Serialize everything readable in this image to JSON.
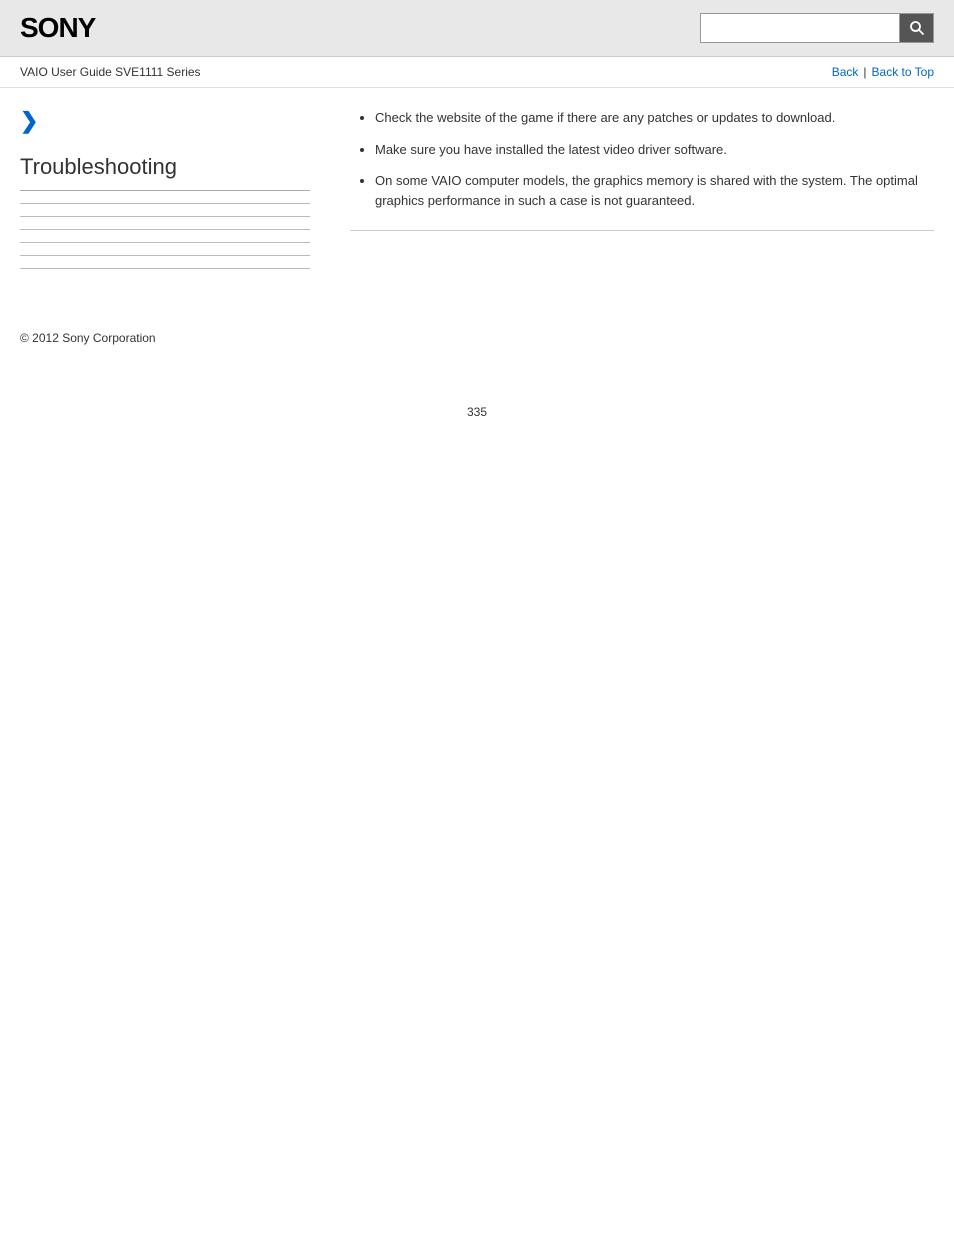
{
  "header": {
    "logo": "SONY",
    "search_placeholder": ""
  },
  "breadcrumb": {
    "guide_title": "VAIO User Guide SVE1111 Series",
    "back_label": "Back",
    "back_to_top_label": "Back to Top",
    "separator": "|"
  },
  "sidebar": {
    "chevron": "❯",
    "heading": "Troubleshooting",
    "dividers": 6
  },
  "content": {
    "bullet_items": [
      "Check the website of the game if there are any patches or updates to download.",
      "Make sure you have installed the latest video driver software.",
      "On some VAIO computer models, the graphics memory is shared with the system. The optimal graphics performance in such a case is not guaranteed."
    ]
  },
  "footer": {
    "copyright": "© 2012 Sony Corporation"
  },
  "page_number": "335",
  "icons": {
    "search": "🔍",
    "chevron_right": "❯"
  }
}
